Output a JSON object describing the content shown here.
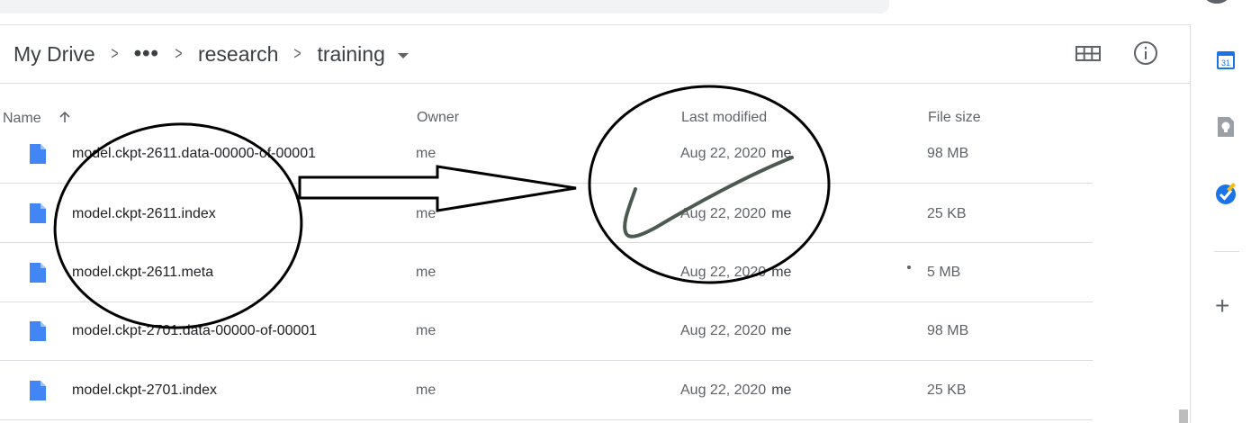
{
  "breadcrumb": {
    "root": "My Drive",
    "ellipsis": "•••",
    "folder1": "research",
    "folder2": "training"
  },
  "columns": {
    "name": "Name",
    "owner": "Owner",
    "modified": "Last modified",
    "size": "File size"
  },
  "rows": [
    {
      "name": "model.ckpt-2611.data-00000-of-00001",
      "owner": "me",
      "modified": "Aug 22, 2020",
      "modified_by": "me",
      "size": "98 MB"
    },
    {
      "name": "model.ckpt-2611.index",
      "owner": "me",
      "modified": "Aug 22, 2020",
      "modified_by": "me",
      "size": "25 KB"
    },
    {
      "name": "model.ckpt-2611.meta",
      "owner": "me",
      "modified": "Aug 22, 2020",
      "modified_by": "me",
      "size": "5 MB"
    },
    {
      "name": "model.ckpt-2701.data-00000-of-00001",
      "owner": "me",
      "modified": "Aug 22, 2020",
      "modified_by": "me",
      "size": "98 MB"
    },
    {
      "name": "model.ckpt-2701.index",
      "owner": "me",
      "modified": "Aug 22, 2020",
      "modified_by": "me",
      "size": "25 KB"
    }
  ],
  "side_panel": {
    "calendar_day": "31"
  },
  "icons": {
    "file": "google-docs-file-icon",
    "grid": "grid-view-icon",
    "info": "info-icon",
    "sort": "arrow-up-icon",
    "calendar": "calendar-icon",
    "keep": "keep-bulb-icon",
    "tasks": "tasks-check-icon",
    "add": "plus-icon"
  },
  "colors": {
    "file_blue": "#4285f4",
    "calendar_blue": "#1a73e8",
    "keep_gray": "#9aa0a6",
    "annotation_black": "#000000",
    "checkmark_gray": "#4a5a50"
  }
}
